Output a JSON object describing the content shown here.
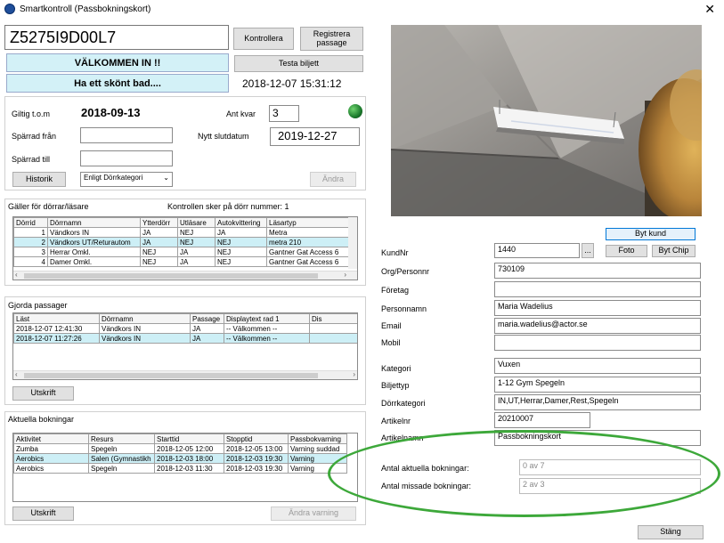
{
  "window": {
    "title": "Smartkontroll  (Passbokningskort)",
    "close": "✕"
  },
  "card_number": "Z5275I9D00L7",
  "buttons": {
    "kontrollera": "Kontrollera",
    "registrera_passage": "Registrera passage",
    "testa_biljett": "Testa biljett",
    "historik": "Historik",
    "andra": "Ändra",
    "utskrift1": "Utskrift",
    "utskrift2": "Utskrift",
    "andra_varning": "Ändra varning",
    "byt_kund": "Byt kund",
    "foto": "Foto",
    "byt_chip": "Byt Chip",
    "dots": "...",
    "stang": "Stäng"
  },
  "messages": {
    "welcome": "VÄLKOMMEN  IN !!",
    "bath": "Ha ett skönt bad...."
  },
  "datetime": "2018-12-07 15:31:12",
  "validity": {
    "giltig_label": "Giltig t.o.m",
    "giltig_value": "2018-09-13",
    "ant_kvar_label": "Ant kvar",
    "ant_kvar_value": "3",
    "sparrad_fran_label": "Spärrad från",
    "nytt_slutdatum_label": "Nytt slutdatum",
    "nytt_slutdatum_value": "2019-12-27",
    "sparrad_till_label": "Spärrad till",
    "category_select": "Enligt Dörrkategori"
  },
  "doors": {
    "title": "Gäller för dörrar/läsare",
    "control_note": "Kontrollen sker på dörr nummer: 1",
    "columns": [
      "Dörrid",
      "Dörrnamn",
      "Ytterdörr",
      "Utläsare",
      "Autokvittering",
      "Läsartyp"
    ],
    "rows": [
      [
        "1",
        "Vändkors IN",
        "JA",
        "NEJ",
        "JA",
        "Metra"
      ],
      [
        "2",
        "Vändkors UT/Returautom",
        "JA",
        "NEJ",
        "NEJ",
        "metra 210"
      ],
      [
        "3",
        "Herrar Omkl.",
        "NEJ",
        "JA",
        "NEJ",
        "Gantner Gat Access 6"
      ],
      [
        "4",
        "Damer Omkl.",
        "NEJ",
        "JA",
        "NEJ",
        "Gantner Gat Access 6"
      ]
    ]
  },
  "passages": {
    "title": "Gjorda passager",
    "columns": [
      "Läst",
      "Dörrnamn",
      "Passage",
      "Displaytext rad 1",
      "Dis"
    ],
    "rows": [
      [
        "2018-12-07 12:41:30",
        "Vändkors IN",
        "JA",
        "-- Välkommen --",
        ""
      ],
      [
        "2018-12-07 11:27:26",
        "Vändkors IN",
        "JA",
        "-- Välkommen --",
        ""
      ]
    ]
  },
  "bookings": {
    "title": "Aktuella bokningar",
    "columns": [
      "Aktivitet",
      "Resurs",
      "Starttid",
      "Stopptid",
      "Passbokvarning"
    ],
    "rows": [
      [
        "Zumba",
        "Spegeln",
        "2018-12-05 12:00",
        "2018-12-05 13:00",
        "Varning suddad"
      ],
      [
        "Aerobics",
        "Salen (Gymnastikh",
        "2018-12-03 18:00",
        "2018-12-03 19:30",
        "Varning"
      ],
      [
        "Aerobics",
        "Spegeln",
        "2018-12-03 11:30",
        "2018-12-03 19:30",
        "Varning"
      ]
    ]
  },
  "customer": {
    "labels": {
      "kundnr": "KundNr",
      "org": "Org/Personnr",
      "foretag": "Företag",
      "personnamn": "Personnamn",
      "email": "Email",
      "mobil": "Mobil",
      "kategori": "Kategori",
      "biljettyp": "Biljettyp",
      "dorrkategori": "Dörrkategori",
      "artikelnr": "Artikelnr",
      "artikelnamn": "Artikelnamn",
      "antal_aktuella": "Antal aktuella bokningar:",
      "antal_missade": "Antal missade bokningar:"
    },
    "values": {
      "kundnr": "1440",
      "org": "730109",
      "foretag": "",
      "personnamn": "Maria Wadelius",
      "email": "maria.wadelius@actor.se",
      "mobil": "",
      "kategori": "Vuxen",
      "biljettyp": "1-12 Gym Spegeln",
      "dorrkategori": "IN,UT,Herrar,Damer,Rest,Spegeln",
      "artikelnr": "20210007",
      "artikelnamn": "Passbokningskort",
      "antal_aktuella": "0 av 7",
      "antal_missade": "2 av 3"
    }
  },
  "colors": {
    "highlight_row": "#cdeff6",
    "annotation": "#3da83a",
    "status_led": "#1b7a2c"
  }
}
